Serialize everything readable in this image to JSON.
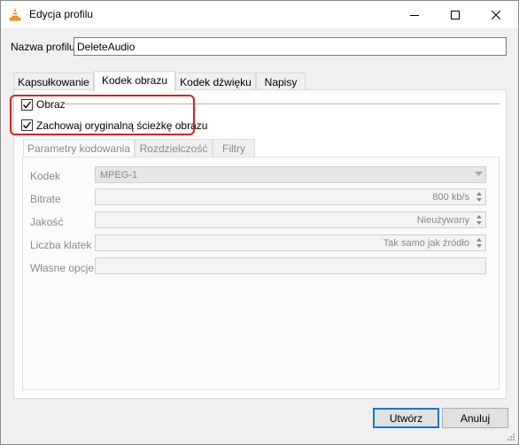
{
  "window": {
    "title": "Edycja profilu",
    "icon": "vlc-cone-icon",
    "controls": [
      "minimize-icon",
      "maximize-icon",
      "close-icon"
    ]
  },
  "profile": {
    "label": "Nazwa profilu",
    "value": "DeleteAudio"
  },
  "tabs": [
    {
      "label": "Kapsułkowanie",
      "active": false
    },
    {
      "label": "Kodek obrazu",
      "active": true
    },
    {
      "label": "Kodek dźwięku",
      "active": false
    },
    {
      "label": "Napisy",
      "active": false
    }
  ],
  "video": {
    "enable_label": "Obraz",
    "enable_checked": true,
    "keep_original_label": "Zachowaj oryginalną ścieżkę obrazu",
    "keep_original_checked": true
  },
  "subtabs": [
    {
      "label": "Parametry kodowania",
      "active": true
    },
    {
      "label": "Rozdzielczość",
      "active": false
    },
    {
      "label": "Filtry",
      "active": false
    }
  ],
  "fields": {
    "codec": {
      "label": "Kodek",
      "value": "MPEG-1"
    },
    "bitrate": {
      "label": "Bitrate",
      "value": "800 kb/s"
    },
    "quality": {
      "label": "Jakość",
      "value": "Nieużywany"
    },
    "framerate": {
      "label": "Liczba klatek",
      "value": "Tak samo jak źródło"
    },
    "custom": {
      "label": "Własne opcje",
      "value": ""
    }
  },
  "buttons": {
    "create": "Utwórz",
    "cancel": "Anuluj"
  },
  "colors": {
    "highlight": "#e0201d",
    "primary_border": "#0078d7",
    "vlc_orange": "#f68b1f"
  }
}
